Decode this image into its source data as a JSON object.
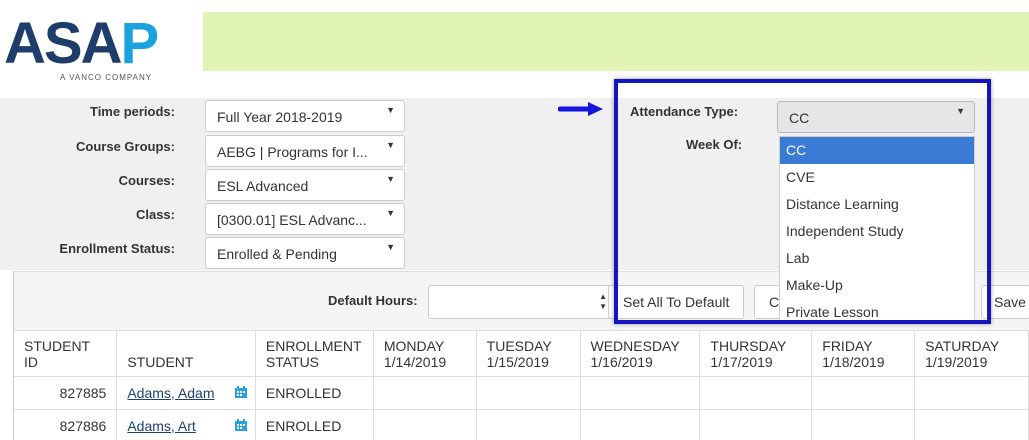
{
  "logo": {
    "text_main": "ASA",
    "text_accent": "P",
    "subtitle": "A VANCO COMPANY"
  },
  "colors": {
    "banner": "#e2f3b6",
    "accent": "#1aa2e0",
    "brand": "#1f3d6b",
    "highlight": "#1515c0",
    "selected": "#3a7bd5"
  },
  "filters": {
    "time_periods": {
      "label": "Time periods:",
      "value": "Full Year 2018-2019"
    },
    "course_groups": {
      "label": "Course Groups:",
      "value": "AEBG | Programs for I..."
    },
    "courses": {
      "label": "Courses:",
      "value": "ESL Advanced"
    },
    "class": {
      "label": "Class:",
      "value": "[0300.01] ESL Advanc..."
    },
    "enrollment_status": {
      "label": "Enrollment Status:",
      "value": "Enrolled & Pending"
    }
  },
  "attendance": {
    "label": "Attendance Type:",
    "value": "CC",
    "week_label": "Week Of:",
    "options": [
      "CC",
      "CVE",
      "Distance Learning",
      "Independent Study",
      "Lab",
      "Make-Up",
      "Private Lesson"
    ]
  },
  "toolbar": {
    "default_hours_label": "Default Hours:",
    "set_all_default": "Set All To Default",
    "clear_partial": "C",
    "save_partial": "Save"
  },
  "table": {
    "headers": [
      [
        "STUDENT ID",
        ""
      ],
      [
        "STUDENT",
        ""
      ],
      [
        "ENROLLMENT",
        "STATUS"
      ],
      [
        "MONDAY",
        "1/14/2019"
      ],
      [
        "TUESDAY",
        "1/15/2019"
      ],
      [
        "WEDNESDAY",
        "1/16/2019"
      ],
      [
        "THURSDAY",
        "1/17/2019"
      ],
      [
        "FRIDAY",
        "1/18/2019"
      ],
      [
        "SATURDAY",
        "1/19/2019"
      ]
    ],
    "rows": [
      {
        "id": "827885",
        "name": "Adams, Adam",
        "status": "ENROLLED"
      },
      {
        "id": "827886",
        "name": "Adams, Art",
        "status": "ENROLLED"
      }
    ]
  },
  "icons": {
    "arrow": "right-arrow-icon",
    "calendar": "calendar-icon",
    "dropdown": "caret-down-icon"
  }
}
